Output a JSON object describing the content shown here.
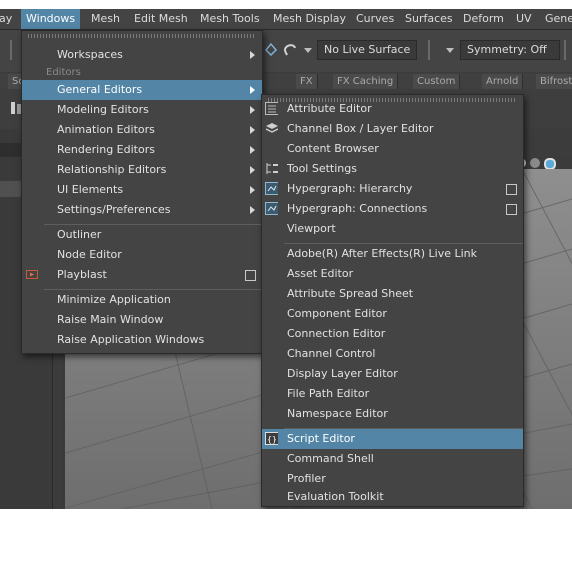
{
  "menubar": {
    "items": [
      "ay",
      "Windows",
      "Mesh",
      "Edit Mesh",
      "Mesh Tools",
      "Mesh Display",
      "Curves",
      "Surfaces",
      "Deform",
      "UV",
      "Gene"
    ],
    "active": "Windows"
  },
  "toolbar": {
    "live_surface": "No Live Surface",
    "symmetry": "Symmetry: Off"
  },
  "shelf_tabs": [
    "Sc",
    "FX",
    "FX Caching",
    "Custom",
    "Arnold",
    "Bifrost"
  ],
  "windows_menu": {
    "items": [
      {
        "label": "Workspaces",
        "submenu": true
      },
      {
        "section": "Editors"
      },
      {
        "label": "General Editors",
        "submenu": true,
        "highlighted": true
      },
      {
        "label": "Modeling Editors",
        "submenu": true
      },
      {
        "label": "Animation Editors",
        "submenu": true
      },
      {
        "label": "Rendering Editors",
        "submenu": true
      },
      {
        "label": "Relationship Editors",
        "submenu": true
      },
      {
        "label": "UI Elements",
        "submenu": true
      },
      {
        "label": "Settings/Preferences",
        "submenu": true
      },
      {
        "label": "Outliner"
      },
      {
        "label": "Node Editor"
      },
      {
        "label": "Playblast",
        "option_box": true,
        "icon": "playblast-icon"
      },
      {
        "label": "Minimize Application"
      },
      {
        "label": "Raise Main Window"
      },
      {
        "label": "Raise Application Windows"
      }
    ]
  },
  "general_editors_menu": {
    "items": [
      {
        "label": "Attribute Editor",
        "icon": "attribute-editor-icon"
      },
      {
        "label": "Channel Box / Layer Editor",
        "icon": "channel-box-icon"
      },
      {
        "label": "Content Browser"
      },
      {
        "label": "Tool Settings",
        "icon": "tool-settings-icon"
      },
      {
        "label": "Hypergraph: Hierarchy",
        "icon": "hypergraph-icon",
        "option_box": true
      },
      {
        "label": "Hypergraph: Connections",
        "icon": "hypergraph-icon",
        "option_box": true
      },
      {
        "label": "Viewport"
      },
      {
        "label": "Adobe(R) After Effects(R) Live Link"
      },
      {
        "label": "Asset Editor"
      },
      {
        "label": "Attribute Spread Sheet"
      },
      {
        "label": "Component Editor"
      },
      {
        "label": "Connection Editor"
      },
      {
        "label": "Channel Control"
      },
      {
        "label": "Display Layer Editor"
      },
      {
        "label": "File Path Editor"
      },
      {
        "label": "Namespace Editor"
      },
      {
        "label": "Script Editor",
        "icon": "script-editor-icon",
        "highlighted": true
      },
      {
        "label": "Command Shell"
      },
      {
        "label": "Profiler"
      },
      {
        "label": "Evaluation Toolkit"
      }
    ]
  },
  "colors": {
    "highlight": "#5285a6",
    "menu_bg": "#444444",
    "app_bg": "#3c3c3c"
  }
}
